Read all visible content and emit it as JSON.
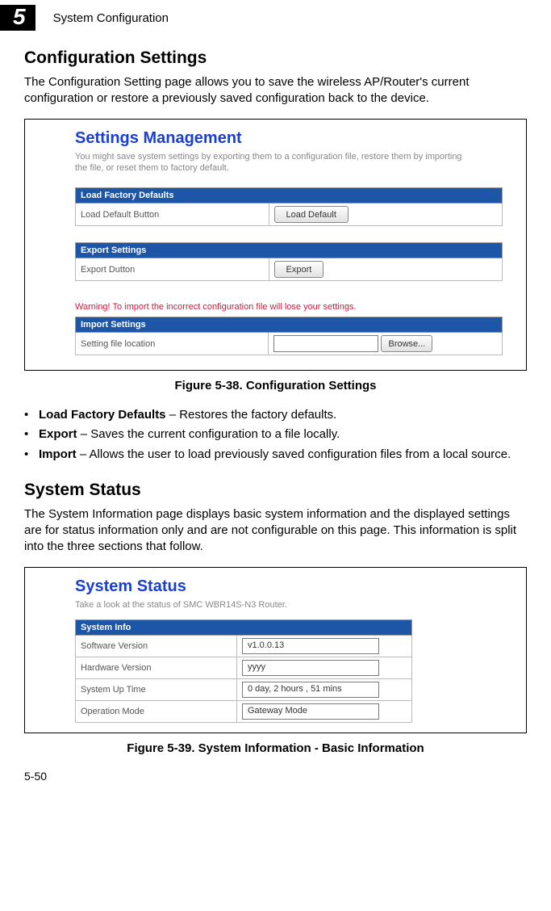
{
  "chapter": {
    "number": "5",
    "title": "System Configuration"
  },
  "section1": {
    "title": "Configuration Settings",
    "intro": "The Configuration Setting page allows you to save the wireless AP/Router's current configuration or restore a previously saved configuration back to the device."
  },
  "fig38": {
    "caption": "Figure 5-38.   Configuration Settings",
    "panel_title": "Settings Management",
    "panel_sub": "You might save system settings by exporting them to a configuration file, restore them by importing the file, or reset them to factory default.",
    "load_header": "Load Factory Defaults",
    "load_label": "Load Default Button",
    "load_btn": "Load Default",
    "export_header": "Export Settings",
    "export_label": "Export Dutton",
    "export_btn": "Export",
    "warning": "Warning! To import the incorrect configuration file will lose your settings.",
    "import_header": "Import Settings",
    "import_label": "Setting file location",
    "browse_btn": "Browse..."
  },
  "bullets": {
    "b1_strong": "Load Factory Defaults",
    "b1_rest": " – Restores the factory defaults.",
    "b2_strong": "Export",
    "b2_rest": " – Saves the current configuration to a file locally.",
    "b3_strong": "Import",
    "b3_rest": " – Allows the user to load previously saved configuration files from a local source."
  },
  "section2": {
    "title": "System Status",
    "intro": "The System Information page displays basic system information and the displayed settings are for status information only and are not configurable on this page. This information is split into the three sections that follow."
  },
  "fig39": {
    "caption": "Figure 5-39.   System Information - Basic Information",
    "panel_title": "System Status",
    "panel_sub": "Take a look at the status of SMC WBR14S-N3 Router.",
    "info_header": "System Info",
    "rows": [
      {
        "label": "Software Version",
        "value": "v1.0.0.13"
      },
      {
        "label": "Hardware Version",
        "value": "yyyy"
      },
      {
        "label": "System Up Time",
        "value": " 0 day,   2 hours  ,  51 mins"
      },
      {
        "label": "Operation Mode",
        "value": "Gateway Mode"
      }
    ]
  },
  "page_num": "5-50"
}
